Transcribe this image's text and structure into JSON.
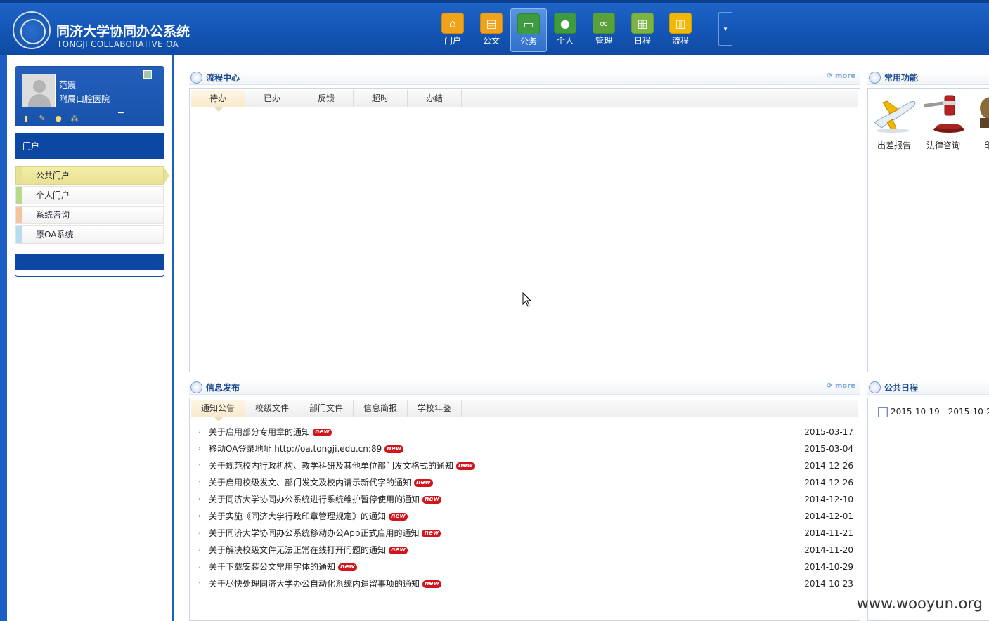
{
  "header": {
    "brand_cn": "同济大学协同办公系统",
    "brand_en": "TONGJI COLLABORATIVE OA",
    "nav": [
      {
        "label": "门户",
        "icon": "home-icon",
        "color": "#f0a21a",
        "active": false
      },
      {
        "label": "公文",
        "icon": "document-icon",
        "color": "#f0a21a",
        "active": false
      },
      {
        "label": "公务",
        "icon": "office-icon",
        "color": "#3f9b3f",
        "active": true
      },
      {
        "label": "个人",
        "icon": "person-icon",
        "color": "#3f9b3f",
        "active": false
      },
      {
        "label": "管理",
        "icon": "infinity-icon",
        "color": "#5aa13a",
        "active": false
      },
      {
        "label": "日程",
        "icon": "calendar-icon",
        "color": "#7cb342",
        "active": false
      },
      {
        "label": "流程",
        "icon": "bar-chart-icon",
        "color": "#f2b705",
        "active": false
      }
    ]
  },
  "sidebar": {
    "user_name": "范震",
    "user_dept": "附属口腔医院",
    "portal_title": "门户",
    "menu": [
      {
        "label": "公共门户",
        "mark_color": "#e8e095",
        "active": true
      },
      {
        "label": "个人门户",
        "mark_color": "#b8d98a",
        "active": false
      },
      {
        "label": "系统咨询",
        "mark_color": "#f5c3a0",
        "active": false
      },
      {
        "label": "原OA系统",
        "mark_color": "#b9dcf3",
        "active": false
      }
    ]
  },
  "workflow": {
    "title": "流程中心",
    "more": "more",
    "tabs": [
      "待办",
      "已办",
      "反馈",
      "超时",
      "办结"
    ]
  },
  "info": {
    "title": "信息发布",
    "more": "more",
    "tabs": [
      "通知公告",
      "校级文件",
      "部门文件",
      "信息简报",
      "学校年鉴"
    ],
    "badge": "new",
    "items": [
      {
        "title": "关于启用部分专用章的通知",
        "date": "2015-03-17"
      },
      {
        "title": "移动OA登录地址 http://oa.tongji.edu.cn:89",
        "date": "2015-03-04"
      },
      {
        "title": "关于规范校内行政机构、教学科研及其他单位部门发文格式的通知",
        "date": "2014-12-26"
      },
      {
        "title": "关于启用校级发文、部门发文及校内请示新代字的通知",
        "date": "2014-12-26"
      },
      {
        "title": "关于同济大学协同办公系统进行系统维护暂停使用的通知",
        "date": "2014-12-10"
      },
      {
        "title": "关于实施《同济大学行政印章管理规定》的通知",
        "date": "2014-12-01"
      },
      {
        "title": "关于同济大学协同办公系统移动办公App正式启用的通知",
        "date": "2014-11-21"
      },
      {
        "title": "关于解决校级文件无法正常在线打开问题的通知",
        "date": "2014-11-20"
      },
      {
        "title": "关于下载安装公文常用字体的通知",
        "date": "2014-10-29"
      },
      {
        "title": "关于尽快处理同济大学办公自动化系统内遗留事项的通知",
        "date": "2014-10-23"
      }
    ]
  },
  "functions": {
    "title": "常用功能",
    "items": [
      {
        "label": "出差报告",
        "icon": "airplane-icon"
      },
      {
        "label": "法律咨询",
        "icon": "gavel-icon"
      },
      {
        "label": "印鉴",
        "icon": "seal-icon"
      }
    ]
  },
  "schedule": {
    "title": "公共日程",
    "entry": "2015-10-19 - 2015-10-2"
  },
  "watermark": "www.wooyun.org"
}
